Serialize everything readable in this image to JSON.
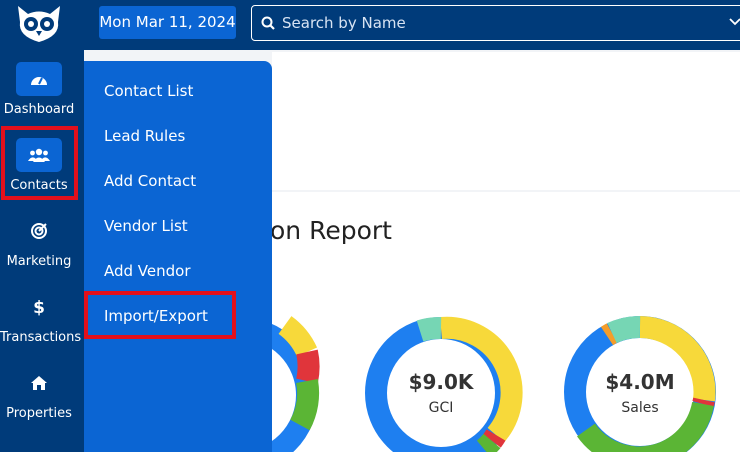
{
  "sidebar": {
    "items": [
      {
        "label": "Dashboard",
        "icon": "gauge-icon"
      },
      {
        "label": "Contacts",
        "icon": "users-icon"
      },
      {
        "label": "Marketing",
        "icon": "target-icon"
      },
      {
        "label": "Transactions",
        "icon": "dollar-icon"
      },
      {
        "label": "Properties",
        "icon": "home-icon"
      }
    ]
  },
  "header": {
    "date": "Mon Mar 11, 2024",
    "search_placeholder": "Search by Name"
  },
  "menu": {
    "items": [
      "Contact List",
      "Lead Rules",
      "Add Contact",
      "Vendor List",
      "Add Vendor",
      "Import/Export"
    ]
  },
  "report": {
    "title": "on Report",
    "donuts": [
      {
        "value": "$9.0K",
        "label": "GCI"
      },
      {
        "value": "$4.0M",
        "label": "Sales"
      }
    ]
  },
  "colors": {
    "sidebar": "#003b7a",
    "accent": "#0b65d3",
    "highlight": "#e3101c",
    "blue": "#1e7ff0",
    "yellow": "#f7d93a",
    "green": "#5bb535",
    "red": "#e0353b",
    "teal": "#76d6b4",
    "orange": "#f59d2a"
  }
}
